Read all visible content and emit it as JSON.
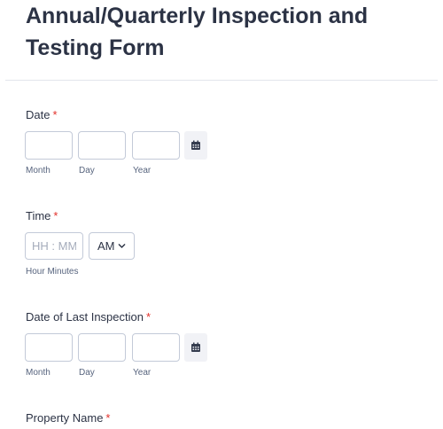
{
  "form": {
    "title": "Annual/Quarterly Inspection and Testing Form"
  },
  "fields": {
    "date": {
      "label": "Date",
      "required_mark": "*",
      "sublabels": {
        "month": "Month",
        "day": "Day",
        "year": "Year"
      },
      "calendar_icon": "calendar-icon"
    },
    "time": {
      "label": "Time",
      "required_mark": "*",
      "placeholder": "HH : MM",
      "ampm_value": "AM",
      "sublabel": "Hour Minutes"
    },
    "last_inspection": {
      "label": "Date of Last Inspection",
      "required_mark": "*",
      "sublabels": {
        "month": "Month",
        "day": "Day",
        "year": "Year"
      },
      "calendar_icon": "calendar-icon"
    },
    "property_name": {
      "label": "Property Name",
      "required_mark": "*"
    }
  },
  "colors": {
    "text": "#2c3345",
    "required": "#e2302a",
    "border": "#c3cad8",
    "sublabel": "#57647e"
  }
}
